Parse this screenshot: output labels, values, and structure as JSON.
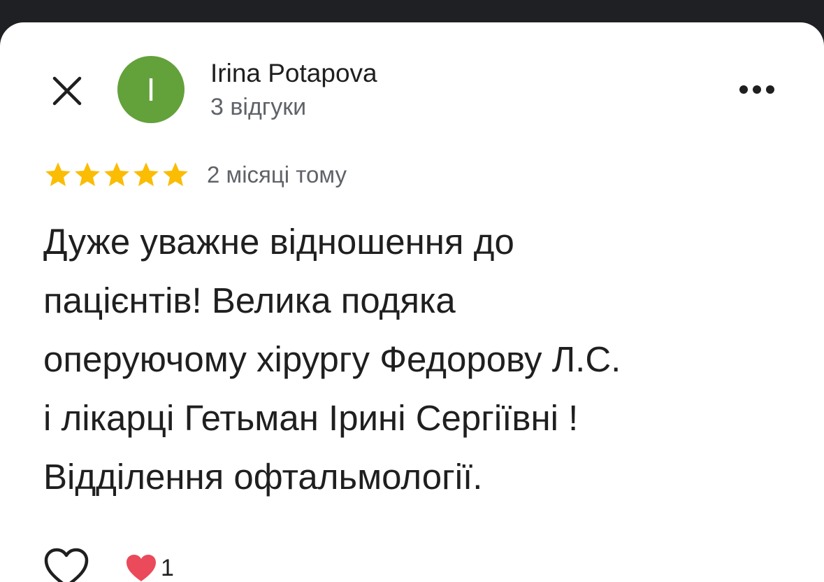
{
  "colors": {
    "avatar_bg": "#63a13b",
    "star": "#fbbc04",
    "text": "#1f1f1f",
    "secondary_text": "#5f6368"
  },
  "header": {
    "close_icon": "close-icon",
    "avatar_letter": "I",
    "author_name": "Irina Potapova",
    "review_count": "3 відгуки",
    "more_icon": "more-horizontal-icon"
  },
  "review": {
    "rating": 5,
    "rating_max": 5,
    "time_ago": "2 місяці тому",
    "text": "Дуже уважне відношення до\nпацієнтів! Велика подяка\nоперуючому хірургу Федорову Л.С.\nі лікарці Гетьман Ірині Сергіївні  !\nВідділення офтальмології."
  },
  "actions": {
    "like_icon": "heart-outline-icon",
    "reaction_icon": "heart-reaction-icon",
    "reaction_count": "1"
  }
}
